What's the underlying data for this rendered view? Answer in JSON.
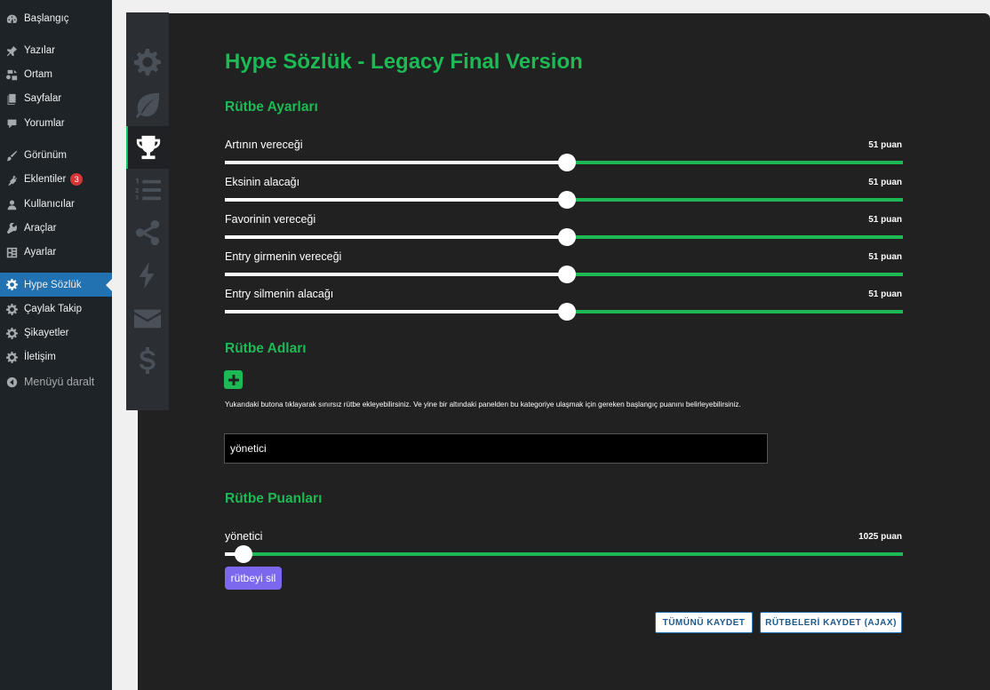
{
  "wp_menu": {
    "items": [
      {
        "label": "Başlangıç",
        "icon": "dashboard-icon"
      },
      {
        "label": "Yazılar",
        "icon": "pin-icon"
      },
      {
        "label": "Ortam",
        "icon": "media-icon"
      },
      {
        "label": "Sayfalar",
        "icon": "page-icon"
      },
      {
        "label": "Yorumlar",
        "icon": "comment-icon"
      },
      {
        "label": "Görünüm",
        "icon": "brush-icon"
      },
      {
        "label": "Eklentiler",
        "icon": "plugin-icon",
        "badge": "3"
      },
      {
        "label": "Kullanıcılar",
        "icon": "user-icon"
      },
      {
        "label": "Araçlar",
        "icon": "wrench-icon"
      },
      {
        "label": "Ayarlar",
        "icon": "settings-grid-icon"
      },
      {
        "label": "Hype Sözlük",
        "icon": "gear-icon",
        "active": true
      },
      {
        "label": "Çaylak Takip",
        "icon": "gear-icon"
      },
      {
        "label": "Şikayetler",
        "icon": "gear-icon"
      },
      {
        "label": "İletişim",
        "icon": "gear-icon"
      },
      {
        "label": "Menüyü daralt",
        "icon": "collapse-icon"
      }
    ]
  },
  "plugin_tabs": [
    "gear-icon",
    "leaf-icon",
    "trophy-icon",
    "ordered-list-icon",
    "share-icon",
    "bolt-icon",
    "envelope-icon",
    "dollar-icon"
  ],
  "active_tab": "trophy-icon",
  "page": {
    "title": "Hype Sözlük - Legacy Final Version",
    "section_settings": "Rütbe Ayarları",
    "sliders": [
      {
        "label": "Artının vereceği",
        "value": "51 puan",
        "fraction": 0.505
      },
      {
        "label": "Eksinin alacağı",
        "value": "51 puan",
        "fraction": 0.505
      },
      {
        "label": "Favorinin vereceği",
        "value": "51 puan",
        "fraction": 0.505
      },
      {
        "label": "Entry girmenin vereceği",
        "value": "51 puan",
        "fraction": 0.505
      },
      {
        "label": "Entry silmenin alacağı",
        "value": "51 puan",
        "fraction": 0.505
      }
    ],
    "section_names": "Rütbe Adları",
    "hint": "Yukarıdaki butona tıklayarak sınırsız rütbe ekleyebilirsiniz. Ve yine bir altındaki panelden bu kategoriye ulaşmak için gereken başlangıç puanını belirleyebilirsiniz.",
    "rank_name_value": "yönetici",
    "section_points": "Rütbe Puanları",
    "rank_slider": {
      "label": "yönetici",
      "value": "1025 puan",
      "fraction": 0.028
    },
    "delete_label": "rütbeyi sil",
    "save_all_label": "TÜMÜNÜ KAYDET",
    "save_ranks_label": "RÜTBELERİ KAYDET (AJAX)"
  },
  "colors": {
    "accent": "#1db954",
    "sidebar": "#1d2327",
    "panel": "#212121",
    "active_menu": "#2271b1",
    "delete_button": "#7b68ee"
  }
}
